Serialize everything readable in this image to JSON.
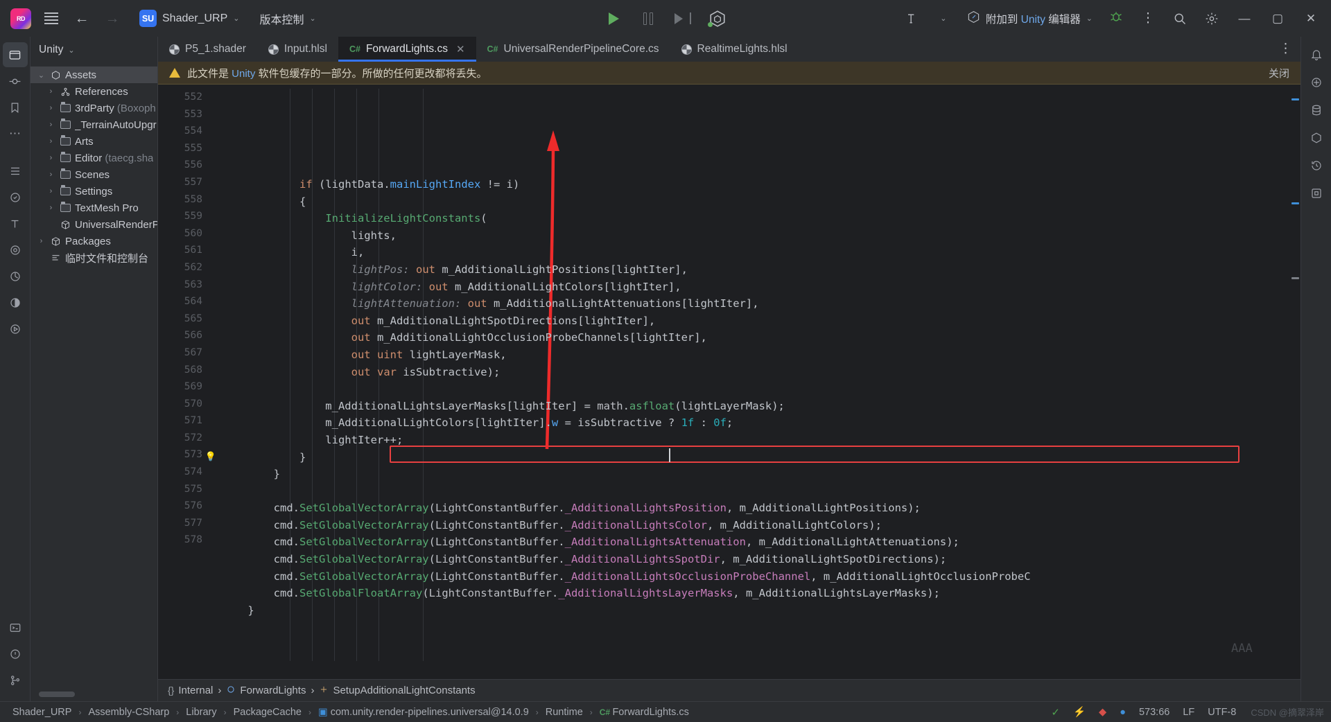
{
  "titlebar": {
    "logo_text": "RD",
    "project_initials": "SU",
    "project_name": "Shader_URP",
    "vcs_label": "版本控制",
    "attach_prefix": "附加到 ",
    "attach_brand": "Unity",
    "attach_suffix": " 编辑器",
    "icons": {
      "menu": "hamburger-menu-icon",
      "back": "←",
      "forward": "→",
      "caret": "⌄",
      "run": "run-icon",
      "pause": "pause-icon",
      "step": "step-over-icon",
      "unity": "unity-icon",
      "build": "build-hammer-icon",
      "debug": "debug-bug-icon",
      "more": "⋮",
      "search": "search-icon",
      "settings": "gear-icon",
      "minimize": "—",
      "maximize": "▢",
      "close": "✕"
    }
  },
  "left_rail": [
    {
      "name": "project",
      "glyph": "▣",
      "active": true
    },
    {
      "name": "commit",
      "glyph": "⎔",
      "active": false
    },
    {
      "name": "bookmarks",
      "glyph": "🔖",
      "active": false
    },
    {
      "name": "more-tools",
      "glyph": "⋯",
      "active": false
    },
    {
      "name": "structure",
      "glyph": "☰",
      "active": false
    },
    {
      "name": "unit-tests",
      "glyph": "⊘",
      "active": false
    },
    {
      "name": "typography",
      "glyph": "T",
      "active": false
    },
    {
      "name": "assembly-explorer",
      "glyph": "◎",
      "active": false
    },
    {
      "name": "profiler",
      "glyph": "◔",
      "active": false
    },
    {
      "name": "dynamic-program-analysis",
      "glyph": "◕",
      "active": false
    },
    {
      "name": "run-panel",
      "glyph": "▶",
      "active": false
    },
    {
      "name": "terminal",
      "glyph": "▭",
      "active": false
    },
    {
      "name": "problems",
      "glyph": "!",
      "active": false
    },
    {
      "name": "version-control",
      "glyph": "⑂",
      "active": false
    }
  ],
  "right_rail": [
    {
      "name": "notifications",
      "glyph": "🔔"
    },
    {
      "name": "ai-assistant",
      "glyph": "◎"
    },
    {
      "name": "database",
      "glyph": "▤"
    },
    {
      "name": "plugins",
      "glyph": "◈"
    },
    {
      "name": "history",
      "glyph": "⟲"
    },
    {
      "name": "nuget",
      "glyph": "◫"
    }
  ],
  "panel": {
    "title": "Unity",
    "tree": [
      {
        "indent": 0,
        "twisty": "⌄",
        "icon": "unity-assets-icon",
        "label": "Assets",
        "sub": "",
        "selected": true
      },
      {
        "indent": 1,
        "twisty": "›",
        "icon": "references-icon",
        "label": "References",
        "sub": "",
        "selected": false
      },
      {
        "indent": 1,
        "twisty": "›",
        "icon": "folder-icon",
        "label": "3rdParty",
        "sub": " (Boxoph",
        "selected": false
      },
      {
        "indent": 1,
        "twisty": "›",
        "icon": "folder-icon",
        "label": "_TerrainAutoUpgr",
        "sub": "",
        "selected": false
      },
      {
        "indent": 1,
        "twisty": "›",
        "icon": "folder-icon",
        "label": "Arts",
        "sub": "",
        "selected": false
      },
      {
        "indent": 1,
        "twisty": "›",
        "icon": "folder-icon",
        "label": "Editor",
        "sub": " (taecg.sha",
        "selected": false
      },
      {
        "indent": 1,
        "twisty": "›",
        "icon": "folder-icon",
        "label": "Scenes",
        "sub": "",
        "selected": false
      },
      {
        "indent": 1,
        "twisty": "›",
        "icon": "folder-icon",
        "label": "Settings",
        "sub": "",
        "selected": false
      },
      {
        "indent": 1,
        "twisty": "›",
        "icon": "folder-icon",
        "label": "TextMesh Pro",
        "sub": "",
        "selected": false
      },
      {
        "indent": 1,
        "twisty": "",
        "icon": "package-icon",
        "label": "UniversalRenderP",
        "sub": "",
        "selected": false
      },
      {
        "indent": 0,
        "twisty": "›",
        "icon": "packages-icon",
        "label": "Packages",
        "sub": "",
        "selected": false
      },
      {
        "indent": 0,
        "twisty": "",
        "icon": "scratches-icon",
        "label": "临时文件和控制台",
        "sub": "",
        "selected": false
      }
    ]
  },
  "tabs": [
    {
      "label": "P5_1.shader",
      "kind": "shader",
      "active": false,
      "closable": false
    },
    {
      "label": "Input.hlsl",
      "kind": "shader",
      "active": false,
      "closable": false
    },
    {
      "label": "ForwardLights.cs",
      "kind": "cs",
      "active": true,
      "closable": true
    },
    {
      "label": "UniversalRenderPipelineCore.cs",
      "kind": "cs",
      "active": false,
      "closable": false
    },
    {
      "label": "RealtimeLights.hlsl",
      "kind": "shader",
      "active": false,
      "closable": false
    }
  ],
  "banner": {
    "text_before": "此文件是 ",
    "brand": "Unity",
    "text_after": " 软件包缓存的一部分。所做的任何更改都将丢失。",
    "close_label": "关闭"
  },
  "code": {
    "first_line": 552,
    "lines": [
      {
        "n": 552,
        "indent": 0,
        "tokens": [
          {
            "t": "            ",
            "c": "var"
          },
          {
            "t": "if",
            "c": "kw"
          },
          {
            "t": " (",
            "c": "var"
          },
          {
            "t": "lightData",
            "c": "var"
          },
          {
            "t": ".",
            "c": "var"
          },
          {
            "t": "mainLightIndex",
            "c": "prop"
          },
          {
            "t": " != ",
            "c": "var"
          },
          {
            "t": "i)",
            "c": "var"
          }
        ]
      },
      {
        "n": 553,
        "indent": 0,
        "tokens": [
          {
            "t": "            {",
            "c": "var"
          }
        ]
      },
      {
        "n": 554,
        "indent": 0,
        "tokens": [
          {
            "t": "                ",
            "c": "var"
          },
          {
            "t": "InitializeLightConstants",
            "c": "mthg"
          },
          {
            "t": "(",
            "c": "var"
          }
        ]
      },
      {
        "n": 555,
        "indent": 0,
        "tokens": [
          {
            "t": "                    lights,",
            "c": "var"
          }
        ]
      },
      {
        "n": 556,
        "indent": 0,
        "tokens": [
          {
            "t": "                    i,",
            "c": "var"
          }
        ]
      },
      {
        "n": 557,
        "indent": 0,
        "tokens": [
          {
            "t": "                    ",
            "c": "var"
          },
          {
            "t": "lightPos:",
            "c": "param"
          },
          {
            "t": " ",
            "c": "var"
          },
          {
            "t": "out",
            "c": "kw"
          },
          {
            "t": " m_AdditionalLightPositions[lightIter],",
            "c": "var"
          }
        ]
      },
      {
        "n": 558,
        "indent": 0,
        "tokens": [
          {
            "t": "                    ",
            "c": "var"
          },
          {
            "t": "lightColor:",
            "c": "param"
          },
          {
            "t": " ",
            "c": "var"
          },
          {
            "t": "out",
            "c": "kw"
          },
          {
            "t": " m_AdditionalLightColors[lightIter],",
            "c": "var"
          }
        ]
      },
      {
        "n": 559,
        "indent": 0,
        "tokens": [
          {
            "t": "                    ",
            "c": "var"
          },
          {
            "t": "lightAttenuation:",
            "c": "param"
          },
          {
            "t": " ",
            "c": "var"
          },
          {
            "t": "out",
            "c": "kw"
          },
          {
            "t": " m_AdditionalLightAttenuations[lightIter],",
            "c": "var"
          }
        ]
      },
      {
        "n": 560,
        "indent": 0,
        "tokens": [
          {
            "t": "                    ",
            "c": "var"
          },
          {
            "t": "out",
            "c": "kw"
          },
          {
            "t": " m_AdditionalLightSpotDirections[lightIter],",
            "c": "var"
          }
        ]
      },
      {
        "n": 561,
        "indent": 0,
        "tokens": [
          {
            "t": "                    ",
            "c": "var"
          },
          {
            "t": "out",
            "c": "kw"
          },
          {
            "t": " m_AdditionalLightOcclusionProbeChannels[lightIter],",
            "c": "var"
          }
        ]
      },
      {
        "n": 562,
        "indent": 0,
        "tokens": [
          {
            "t": "                    ",
            "c": "var"
          },
          {
            "t": "out",
            "c": "kw"
          },
          {
            "t": " ",
            "c": "var"
          },
          {
            "t": "uint",
            "c": "kw"
          },
          {
            "t": " lightLayerMask,",
            "c": "var"
          }
        ]
      },
      {
        "n": 563,
        "indent": 0,
        "tokens": [
          {
            "t": "                    ",
            "c": "var"
          },
          {
            "t": "out",
            "c": "kw"
          },
          {
            "t": " ",
            "c": "var"
          },
          {
            "t": "var",
            "c": "kw"
          },
          {
            "t": " isSubtractive);",
            "c": "var"
          }
        ]
      },
      {
        "n": 564,
        "indent": 0,
        "tokens": [
          {
            "t": "",
            "c": "var"
          }
        ]
      },
      {
        "n": 565,
        "indent": 0,
        "tokens": [
          {
            "t": "                m_AdditionalLightsLayerMasks[lightIter] = ",
            "c": "var"
          },
          {
            "t": "math",
            "c": "cls"
          },
          {
            "t": ".",
            "c": "var"
          },
          {
            "t": "asfloat",
            "c": "mthg"
          },
          {
            "t": "(lightLayerMask);",
            "c": "var"
          }
        ]
      },
      {
        "n": 566,
        "indent": 0,
        "tokens": [
          {
            "t": "                m_AdditionalLightColors[lightIter].",
            "c": "var"
          },
          {
            "t": "w",
            "c": "prop"
          },
          {
            "t": " = isSubtractive ? ",
            "c": "var"
          },
          {
            "t": "1f",
            "c": "num"
          },
          {
            "t": " : ",
            "c": "var"
          },
          {
            "t": "0f",
            "c": "num"
          },
          {
            "t": ";",
            "c": "var"
          }
        ]
      },
      {
        "n": 567,
        "indent": 0,
        "tokens": [
          {
            "t": "                lightIter++;",
            "c": "var"
          }
        ]
      },
      {
        "n": 568,
        "indent": 0,
        "tokens": [
          {
            "t": "            }",
            "c": "var"
          }
        ]
      },
      {
        "n": 569,
        "indent": 0,
        "tokens": [
          {
            "t": "        }",
            "c": "var"
          }
        ]
      },
      {
        "n": 570,
        "indent": 0,
        "tokens": [
          {
            "t": "",
            "c": "var"
          }
        ]
      },
      {
        "n": 571,
        "indent": 0,
        "tokens": [
          {
            "t": "        cmd",
            "c": "var"
          },
          {
            "t": ".",
            "c": "var"
          },
          {
            "t": "SetGlobalVectorArray",
            "c": "mthg"
          },
          {
            "t": "(",
            "c": "var"
          },
          {
            "t": "LightConstantBuffer",
            "c": "cls"
          },
          {
            "t": ".",
            "c": "var"
          },
          {
            "t": "_AdditionalLightsPosition",
            "c": "fld"
          },
          {
            "t": ", m_AdditionalLightPositions);",
            "c": "var"
          }
        ]
      },
      {
        "n": 572,
        "indent": 0,
        "tokens": [
          {
            "t": "        cmd",
            "c": "var"
          },
          {
            "t": ".",
            "c": "var"
          },
          {
            "t": "SetGlobalVectorArray",
            "c": "mthg"
          },
          {
            "t": "(",
            "c": "var"
          },
          {
            "t": "LightConstantBuffer",
            "c": "cls"
          },
          {
            "t": ".",
            "c": "var"
          },
          {
            "t": "_AdditionalLightsColor",
            "c": "fld"
          },
          {
            "t": ", m_AdditionalLightColors);",
            "c": "var"
          }
        ]
      },
      {
        "n": 573,
        "indent": 0,
        "highlight": true,
        "bulb": true,
        "tokens": [
          {
            "t": "        cmd",
            "c": "var"
          },
          {
            "t": ".",
            "c": "var"
          },
          {
            "t": "SetGlobalVectorArray",
            "c": "mthg"
          },
          {
            "t": "(",
            "c": "var"
          },
          {
            "t": "LightConstantBuffer",
            "c": "cls"
          },
          {
            "t": ".",
            "c": "var"
          },
          {
            "t": "_AdditionalLightsAttenuation",
            "c": "fld"
          },
          {
            "t": ", m_AdditionalLightAttenuations);",
            "c": "var"
          }
        ]
      },
      {
        "n": 574,
        "indent": 0,
        "tokens": [
          {
            "t": "        cmd",
            "c": "var"
          },
          {
            "t": ".",
            "c": "var"
          },
          {
            "t": "SetGlobalVectorArray",
            "c": "mthg"
          },
          {
            "t": "(",
            "c": "var"
          },
          {
            "t": "LightConstantBuffer",
            "c": "cls"
          },
          {
            "t": ".",
            "c": "var"
          },
          {
            "t": "_AdditionalLightsSpotDir",
            "c": "fld"
          },
          {
            "t": ", m_AdditionalLightSpotDirections);",
            "c": "var"
          }
        ]
      },
      {
        "n": 575,
        "indent": 0,
        "tokens": [
          {
            "t": "        cmd",
            "c": "var"
          },
          {
            "t": ".",
            "c": "var"
          },
          {
            "t": "SetGlobalVectorArray",
            "c": "mthg"
          },
          {
            "t": "(",
            "c": "var"
          },
          {
            "t": "LightConstantBuffer",
            "c": "cls"
          },
          {
            "t": ".",
            "c": "var"
          },
          {
            "t": "_AdditionalLightsOcclusionProbeChannel",
            "c": "fld"
          },
          {
            "t": ", m_AdditionalLightOcclusionProbeC",
            "c": "var"
          }
        ]
      },
      {
        "n": 576,
        "indent": 0,
        "tokens": [
          {
            "t": "        cmd",
            "c": "var"
          },
          {
            "t": ".",
            "c": "var"
          },
          {
            "t": "SetGlobalFloatArray",
            "c": "mthg"
          },
          {
            "t": "(",
            "c": "var"
          },
          {
            "t": "LightConstantBuffer",
            "c": "cls"
          },
          {
            "t": ".",
            "c": "var"
          },
          {
            "t": "_AdditionalLightsLayerMasks",
            "c": "fld"
          },
          {
            "t": ", m_AdditionalLightsLayerMasks);",
            "c": "var"
          }
        ]
      },
      {
        "n": 577,
        "indent": 0,
        "tokens": [
          {
            "t": "    }",
            "c": "var"
          }
        ]
      },
      {
        "n": 578,
        "indent": 0,
        "tokens": [
          {
            "t": "",
            "c": "var"
          }
        ]
      }
    ]
  },
  "breadcrumbs": [
    {
      "icon": "braces-icon",
      "label": "Internal"
    },
    {
      "icon": "class-icon",
      "label": "ForwardLights"
    },
    {
      "icon": "method-icon",
      "label": "SetupAdditionalLightConstants"
    }
  ],
  "status": {
    "path": [
      {
        "label": "Shader_URP",
        "icon": ""
      },
      {
        "label": "Assembly-CSharp",
        "icon": ""
      },
      {
        "label": "Library",
        "icon": ""
      },
      {
        "label": "PackageCache",
        "icon": ""
      },
      {
        "label": "com.unity.render-pipelines.universal@14.0.9",
        "icon": "package-icon"
      },
      {
        "label": "Runtime",
        "icon": ""
      },
      {
        "label": "ForwardLights.cs",
        "icon": "cs-icon"
      }
    ],
    "caret_position": "573:66",
    "line_ending": "LF",
    "encoding": "UTF-8",
    "indent": "4",
    "watermark": "CSDN @摘翠泽岸",
    "inspection_ok": "✓",
    "warn_count": "",
    "markers": {
      "warning": "⚡",
      "error": "",
      "info": ""
    }
  }
}
